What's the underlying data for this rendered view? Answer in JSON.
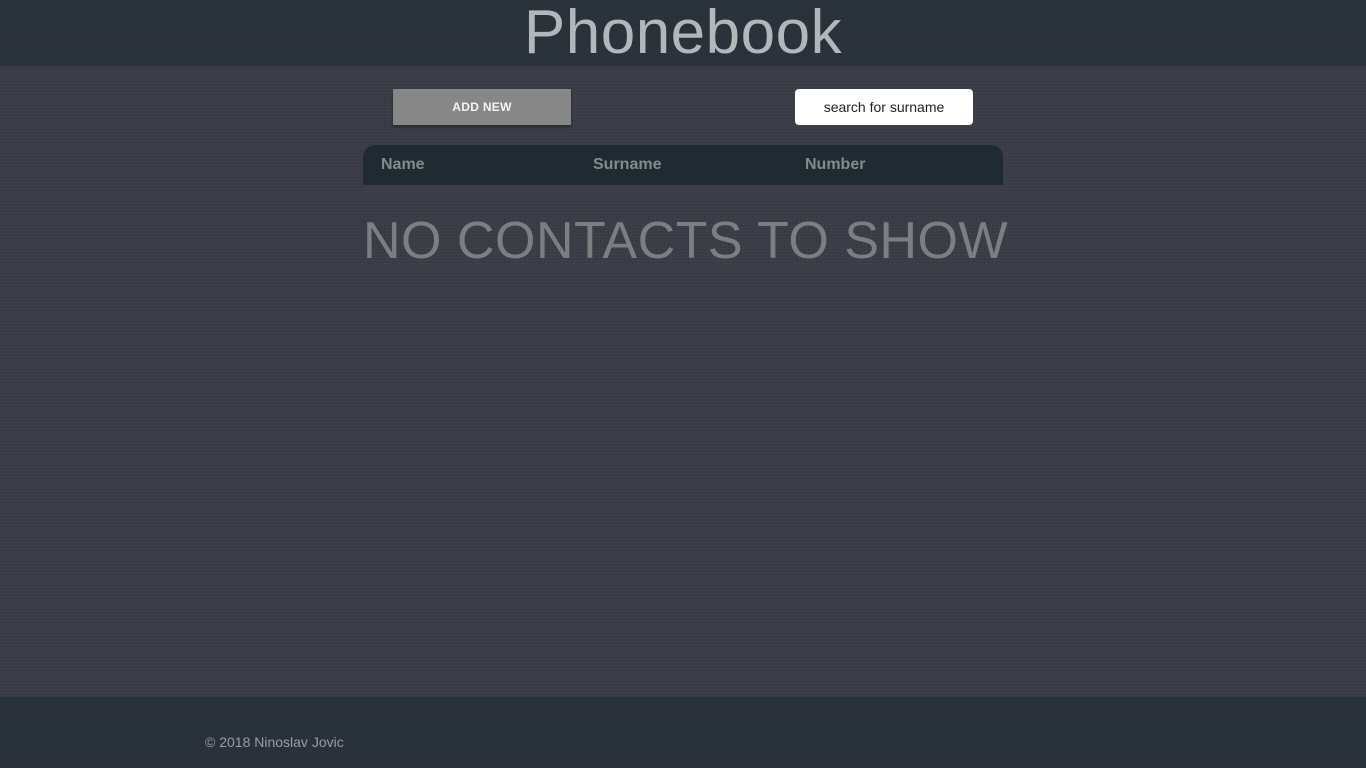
{
  "header": {
    "title": "Phonebook"
  },
  "toolbar": {
    "add_label": "ADD NEW",
    "search_placeholder": "search for surname"
  },
  "table": {
    "columns": [
      "Name",
      "Surname",
      "Number"
    ],
    "rows": [],
    "empty_message": "NO CONTACTS TO SHOW"
  },
  "footer": {
    "copyright": "© 2018 Ninoslav Jovic"
  },
  "colors": {
    "background": "#3a3d46",
    "header_bar": "#283038",
    "table_header": "#1f2b30",
    "button": "#878787"
  }
}
